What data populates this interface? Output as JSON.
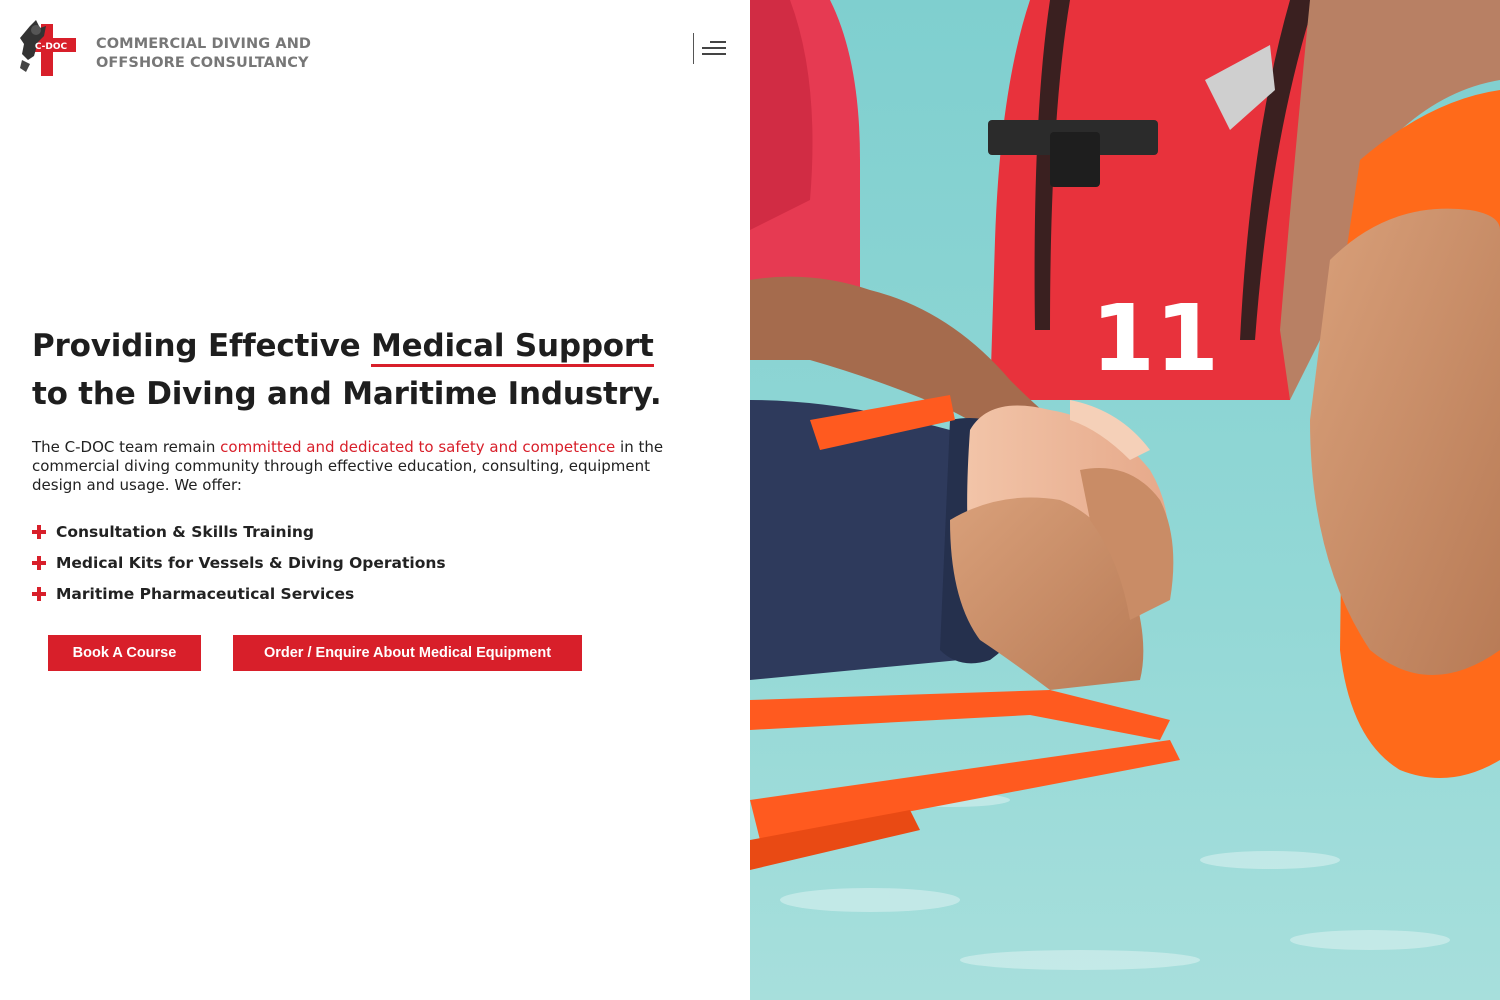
{
  "brand": {
    "logo_text": "C-DOC",
    "name_line1": "COMMERCIAL DIVING AND",
    "name_line2": "OFFSHORE CONSULTANCY"
  },
  "header": {
    "menu_icon": "hamburger-menu-icon"
  },
  "hero": {
    "title_part1": "Providing Effective ",
    "title_highlight": "Medical Support",
    "title_part2": " to the Diving and Maritime Industry.",
    "intro_part1": "The C-DOC team remain ",
    "intro_accent": "committed and dedicated to safety and competence",
    "intro_part2": " in the commercial diving community through effective education, consulting, equipment design and usage. We offer:"
  },
  "offers": [
    {
      "label": "Consultation & Skills Training",
      "icon": "plus-icon"
    },
    {
      "label": "Medical Kits for Vessels & Diving Operations",
      "icon": "plus-icon"
    },
    {
      "label": "Maritime Pharmaceutical Services",
      "icon": "plus-icon"
    }
  ],
  "buttons": {
    "book_course": "Book A Course",
    "order_equipment": "Order / Enquire About Medical Equipment"
  },
  "photo": {
    "vest_number": "11"
  },
  "colors": {
    "accent": "#d81f2a",
    "brand_gray": "#777777",
    "water": "#8fd3d2",
    "vest_red": "#e8323c",
    "vest_orange": "#ff6a1a"
  }
}
